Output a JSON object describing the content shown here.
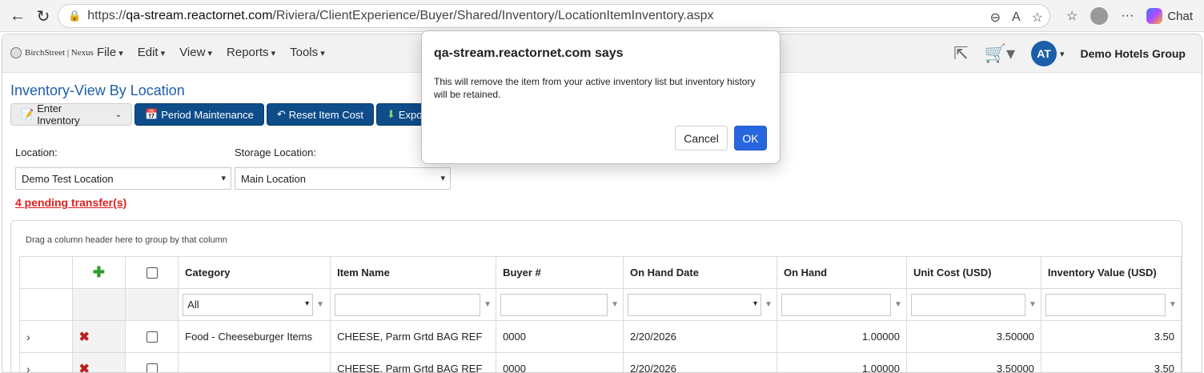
{
  "browser": {
    "url_prefix": "https://",
    "url_host": "qa-stream.reactornet.com",
    "url_path": "/Riviera/ClientExperience/Buyer/Shared/Inventory/LocationItemInventory.aspx",
    "chat_label": "Chat"
  },
  "app": {
    "brand": "BirchStreet | Nexus",
    "menu": [
      "File",
      "Edit",
      "View",
      "Reports",
      "Tools"
    ],
    "avatar_initials": "AT",
    "org_name": "Demo Hotels Group"
  },
  "page": {
    "title": "Inventory-View By Location",
    "toolbar": {
      "enter_inventory": "Enter Inventory",
      "period_maintenance": "Period Maintenance",
      "reset_item_cost": "Reset Item Cost",
      "export_partial": "Expo"
    },
    "location_label": "Location:",
    "location_value": "Demo Test Location",
    "storage_label": "Storage Location:",
    "storage_value": "Main Location",
    "pending_link": "4 pending transfer(s)"
  },
  "grid": {
    "group_hint": "Drag a column header here to group by that column",
    "columns": [
      "Category",
      "Item Name",
      "Buyer #",
      "On Hand Date",
      "On Hand",
      "Unit Cost (USD)",
      "Inventory Value (USD)"
    ],
    "category_filter": "All",
    "rows": [
      {
        "category": "Food - Cheeseburger Items",
        "item": "CHEESE, Parm Grtd BAG REF",
        "buyer": "0000",
        "date": "2/20/2026",
        "on_hand": "1.00000",
        "unit_cost": "3.50000",
        "value": "3.50"
      },
      {
        "category": "",
        "item": "CHEESE, Parm Grtd BAG REF",
        "buyer": "0000",
        "date": "2/20/2026",
        "on_hand": "1.00000",
        "unit_cost": "3.50000",
        "value": "3.50"
      }
    ]
  },
  "dialog": {
    "title": "qa-stream.reactornet.com says",
    "message": "This will remove the item from your active inventory list but inventory history will be retained.",
    "cancel": "Cancel",
    "ok": "OK"
  }
}
